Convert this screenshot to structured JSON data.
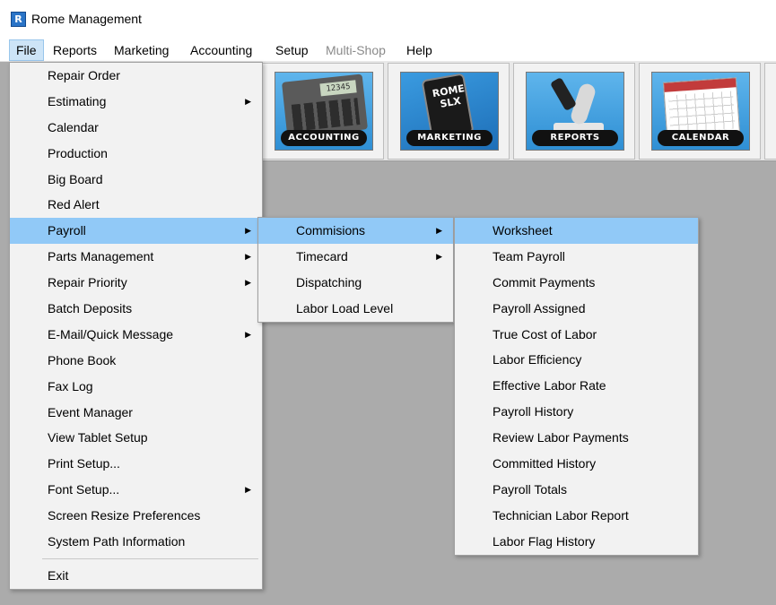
{
  "window": {
    "title": "Rome Management",
    "icon": "rome-app-icon"
  },
  "menubar": [
    {
      "label": "File",
      "state": "active"
    },
    {
      "label": "Reports",
      "state": "normal"
    },
    {
      "label": "Marketing",
      "state": "normal"
    },
    {
      "label": "Accounting",
      "state": "normal"
    },
    {
      "label": "Setup",
      "state": "normal"
    },
    {
      "label": "Multi-Shop",
      "state": "disabled"
    },
    {
      "label": "Help",
      "state": "normal"
    }
  ],
  "toolbar": {
    "tiles": [
      {
        "label": "ACCOUNTING",
        "icon": "calculator-icon",
        "screen": "12345"
      },
      {
        "label": "MARKETING",
        "icon": "phone-icon",
        "text": "ROME SLX"
      },
      {
        "label": "REPORTS",
        "icon": "microscope-icon"
      },
      {
        "label": "CALENDAR",
        "icon": "calendar-icon"
      }
    ]
  },
  "file_menu": {
    "items": [
      {
        "label": "Repair Order",
        "submenu": false
      },
      {
        "label": "Estimating",
        "submenu": true
      },
      {
        "label": "Calendar",
        "submenu": false
      },
      {
        "label": "Production",
        "submenu": false
      },
      {
        "label": "Big Board",
        "submenu": false
      },
      {
        "label": "Red Alert",
        "submenu": false
      },
      {
        "label": "Payroll",
        "submenu": true,
        "highlighted": true
      },
      {
        "label": "Parts Management",
        "submenu": true
      },
      {
        "label": "Repair Priority",
        "submenu": true
      },
      {
        "label": "Batch Deposits",
        "submenu": false
      },
      {
        "label": "E-Mail/Quick Message",
        "submenu": true
      },
      {
        "label": "Phone Book",
        "submenu": false
      },
      {
        "label": "Fax Log",
        "submenu": false
      },
      {
        "label": "Event Manager",
        "submenu": false
      },
      {
        "label": "View Tablet Setup",
        "submenu": false
      },
      {
        "label": "Print Setup...",
        "submenu": false
      },
      {
        "label": "Font Setup...",
        "submenu": true
      },
      {
        "label": "Screen Resize Preferences",
        "submenu": false
      },
      {
        "label": "System Path Information",
        "submenu": false
      }
    ],
    "exit_label": "Exit"
  },
  "payroll_menu": {
    "items": [
      {
        "label": "Commisions",
        "submenu": true,
        "highlighted": true
      },
      {
        "label": "Timecard",
        "submenu": true
      },
      {
        "label": "Dispatching",
        "submenu": false
      },
      {
        "label": "Labor Load Level",
        "submenu": false
      }
    ]
  },
  "commisions_menu": {
    "items": [
      {
        "label": "Worksheet",
        "highlighted": true
      },
      {
        "label": "Team Payroll"
      },
      {
        "label": "Commit Payments"
      },
      {
        "label": "Payroll Assigned"
      },
      {
        "label": "True Cost of Labor"
      },
      {
        "label": "Labor Efficiency"
      },
      {
        "label": "Effective Labor Rate"
      },
      {
        "label": "Payroll History"
      },
      {
        "label": "Review Labor Payments"
      },
      {
        "label": "Committed History"
      },
      {
        "label": "Payroll Totals"
      },
      {
        "label": "Technician Labor Report"
      },
      {
        "label": "Labor Flag History"
      }
    ]
  },
  "colors": {
    "highlight": "#91c9f7",
    "menu_bg": "#f2f2f2",
    "workspace": "#ababab",
    "active_menubar": "#cde4f7"
  }
}
